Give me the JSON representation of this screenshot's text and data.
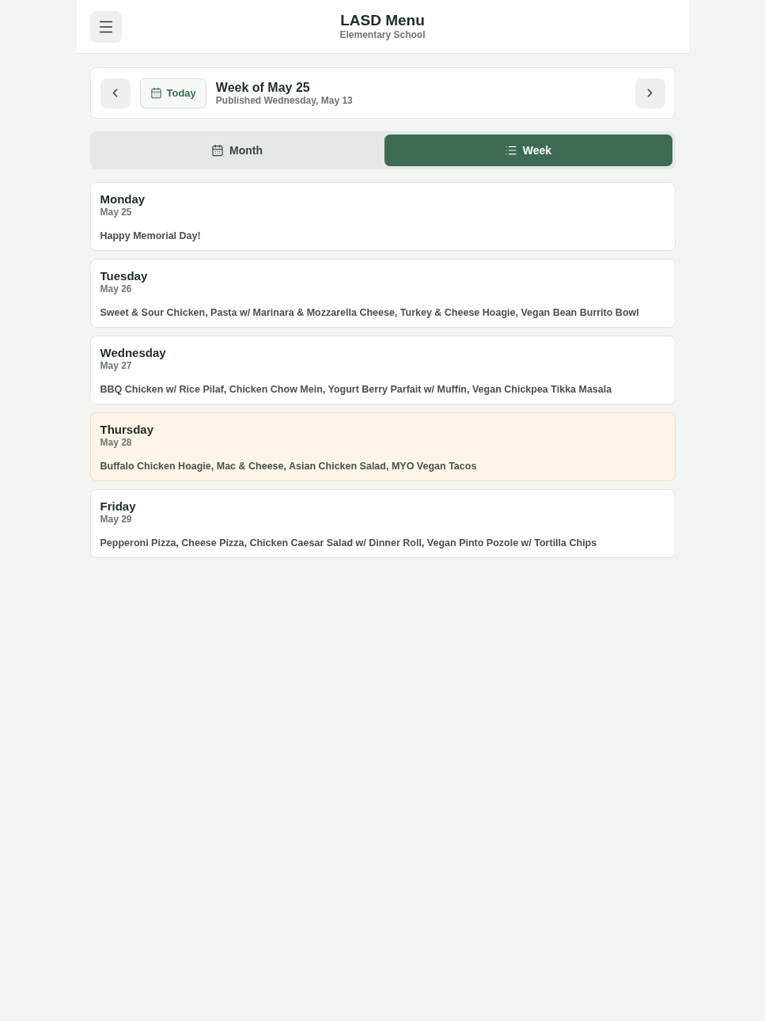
{
  "header": {
    "title": "LASD Menu",
    "subtitle": "Elementary School"
  },
  "week_nav": {
    "today_button": "Today",
    "title": "Week of May 25",
    "published": "Published Wednesday, May 13"
  },
  "view_tabs": [
    {
      "label": "Month",
      "selected": false
    },
    {
      "label": "Week",
      "selected": true
    }
  ],
  "days": [
    {
      "name": "Monday",
      "date": "May 25",
      "menu": "Happy Memorial Day!",
      "today": false
    },
    {
      "name": "Tuesday",
      "date": "May 26",
      "menu": "Sweet & Sour Chicken, Pasta w/ Marinara & Mozzarella Cheese, Turkey & Cheese Hoagie, Vegan Bean Burrito Bowl",
      "today": false
    },
    {
      "name": "Wednesday",
      "date": "May 27",
      "menu": "BBQ Chicken w/ Rice Pilaf, Chicken Chow Mein, Yogurt Berry Parfait w/ Muffin, Vegan Chickpea Tikka Masala",
      "today": false
    },
    {
      "name": "Thursday",
      "date": "May 28",
      "menu": "Buffalo Chicken Hoagie, Mac & Cheese, Asian Chicken Salad, MYO Vegan Tacos",
      "today": true
    },
    {
      "name": "Friday",
      "date": "May 29",
      "menu": "Pepperoni Pizza, Cheese Pizza, Chicken Caesar Salad w/ Dinner Roll, Vegan Pinto Pozole w/ Tortilla Chips",
      "today": false
    }
  ]
}
